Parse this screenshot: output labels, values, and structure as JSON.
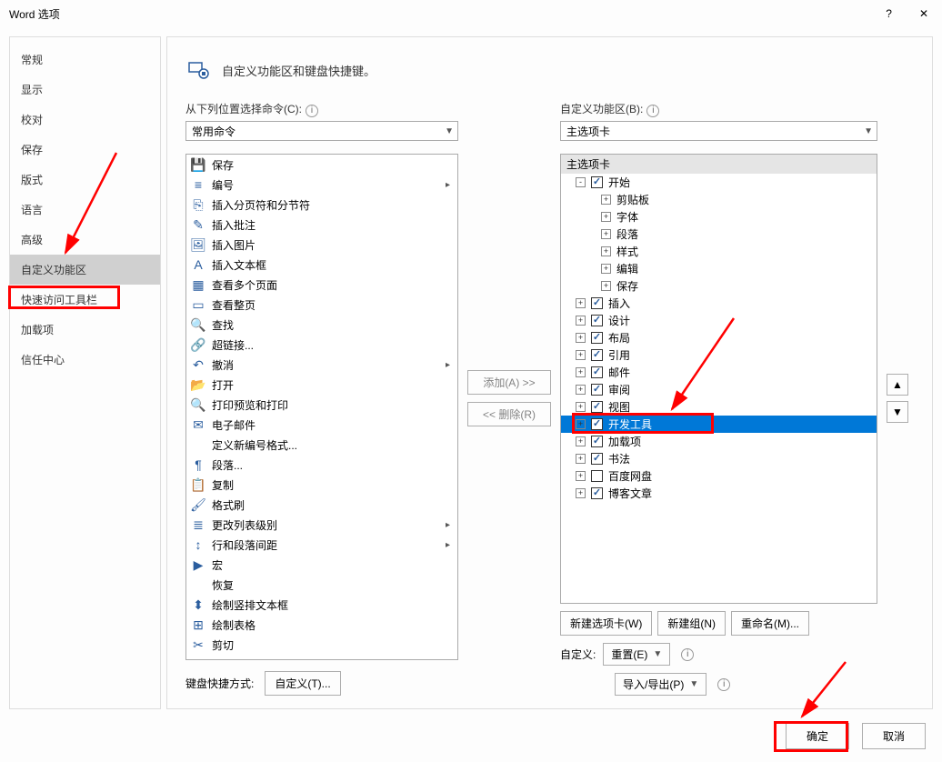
{
  "titlebar": {
    "title": "Word 选项",
    "help": "?",
    "close": "✕"
  },
  "sidebar": {
    "items": [
      {
        "label": "常规"
      },
      {
        "label": "显示"
      },
      {
        "label": "校对"
      },
      {
        "label": "保存"
      },
      {
        "label": "版式"
      },
      {
        "label": "语言"
      },
      {
        "label": "高级"
      },
      {
        "label": "自定义功能区",
        "active": true
      },
      {
        "label": "快速访问工具栏"
      },
      {
        "label": "加载项"
      },
      {
        "label": "信任中心"
      }
    ]
  },
  "header": {
    "title": "自定义功能区和键盘快捷键。"
  },
  "leftcol": {
    "label": "从下列位置选择命令(C):",
    "dropdown": "常用命令",
    "items": [
      {
        "icon": "💾",
        "label": "保存"
      },
      {
        "icon": "≡",
        "label": "编号",
        "arrow": true
      },
      {
        "icon": "⎘",
        "label": "插入分页符和分节符"
      },
      {
        "icon": "✎",
        "label": "插入批注"
      },
      {
        "icon": "🖼",
        "label": "插入图片"
      },
      {
        "icon": "A",
        "label": "插入文本框"
      },
      {
        "icon": "▦",
        "label": "查看多个页面"
      },
      {
        "icon": "▭",
        "label": "查看整页"
      },
      {
        "icon": "🔍",
        "label": "查找"
      },
      {
        "icon": "🔗",
        "label": "超链接..."
      },
      {
        "icon": "↶",
        "label": "撤消",
        "arrow": true
      },
      {
        "icon": "📂",
        "label": "打开"
      },
      {
        "icon": "🔍",
        "label": "打印预览和打印"
      },
      {
        "icon": "✉",
        "label": "电子邮件"
      },
      {
        "icon": "",
        "label": "定义新编号格式..."
      },
      {
        "icon": "¶",
        "label": "段落..."
      },
      {
        "icon": "📋",
        "label": "复制"
      },
      {
        "icon": "🖌",
        "label": "格式刷"
      },
      {
        "icon": "≣",
        "label": "更改列表级别",
        "arrow": true
      },
      {
        "icon": "↕",
        "label": "行和段落间距",
        "arrow": true
      },
      {
        "icon": "▶",
        "label": "宏"
      },
      {
        "icon": "",
        "label": "恢复"
      },
      {
        "icon": "⬍",
        "label": "绘制竖排文本框"
      },
      {
        "icon": "⊞",
        "label": "绘制表格"
      },
      {
        "icon": "✂",
        "label": "剪切"
      }
    ]
  },
  "midcol": {
    "add": "添加(A) >>",
    "remove": "<< 删除(R)"
  },
  "rightcol": {
    "label": "自定义功能区(B):",
    "dropdown": "主选项卡",
    "tree_header": "主选项卡",
    "tree": [
      {
        "type": "main",
        "expand": "-",
        "checked": true,
        "label": "开始"
      },
      {
        "type": "sub",
        "expand": "+",
        "label": "剪贴板"
      },
      {
        "type": "sub",
        "expand": "+",
        "label": "字体"
      },
      {
        "type": "sub",
        "expand": "+",
        "label": "段落"
      },
      {
        "type": "sub",
        "expand": "+",
        "label": "样式"
      },
      {
        "type": "sub",
        "expand": "+",
        "label": "编辑"
      },
      {
        "type": "sub",
        "expand": "+",
        "label": "保存"
      },
      {
        "type": "main",
        "expand": "+",
        "checked": true,
        "label": "插入"
      },
      {
        "type": "main",
        "expand": "+",
        "checked": true,
        "label": "设计"
      },
      {
        "type": "main",
        "expand": "+",
        "checked": true,
        "label": "布局"
      },
      {
        "type": "main",
        "expand": "+",
        "checked": true,
        "label": "引用"
      },
      {
        "type": "main",
        "expand": "+",
        "checked": true,
        "label": "邮件"
      },
      {
        "type": "main",
        "expand": "+",
        "checked": true,
        "label": "审阅"
      },
      {
        "type": "main",
        "expand": "+",
        "checked": true,
        "label": "视图"
      },
      {
        "type": "main",
        "expand": "+",
        "checked": true,
        "label": "开发工具",
        "selected": true
      },
      {
        "type": "main",
        "expand": "+",
        "checked": true,
        "label": "加载项"
      },
      {
        "type": "main",
        "expand": "+",
        "checked": true,
        "label": "书法"
      },
      {
        "type": "main",
        "expand": "+",
        "checked": false,
        "label": "百度网盘"
      },
      {
        "type": "main",
        "expand": "+",
        "checked": true,
        "label": "博客文章"
      }
    ],
    "new_tab": "新建选项卡(W)",
    "new_group": "新建组(N)",
    "rename": "重命名(M)...",
    "custom_label": "自定义:",
    "reset": "重置(E)",
    "import_export": "导入/导出(P)"
  },
  "keyboard": {
    "label": "键盘快捷方式:",
    "btn": "自定义(T)..."
  },
  "footer": {
    "ok": "确定",
    "cancel": "取消"
  }
}
